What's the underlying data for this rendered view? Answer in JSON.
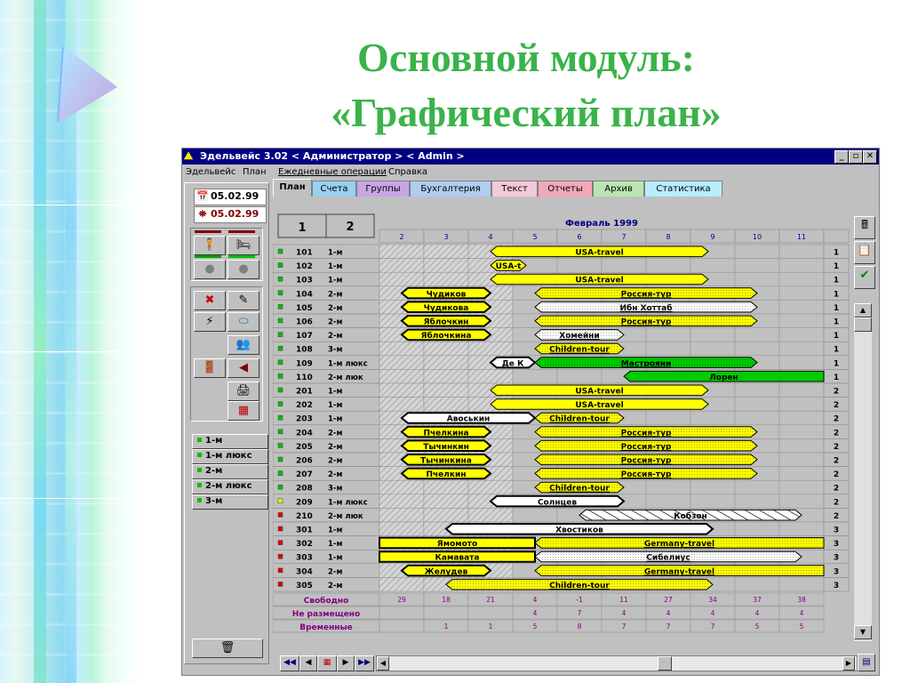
{
  "slide": {
    "title_line1": "Основной модуль:",
    "title_line2": "«Графический план»"
  },
  "app": {
    "title": "Эдельвейс 3.02 < Администратор > < Admin >",
    "menu": [
      "Эдельвейс",
      "План",
      "Ежедневные операции",
      "Справка"
    ],
    "date_today": "05.02.99",
    "date_plan": "05.02.99",
    "tabs": [
      "План",
      "Счета",
      "Группы",
      "Бухгалтерия",
      "Текст",
      "Отчеты",
      "Архив",
      "Статистика"
    ],
    "tab_colors": [
      "#c0c0c0",
      "#9ad0f0",
      "#c9a5e6",
      "#b0ccf0",
      "#f4c9d9",
      "#f2a8b8",
      "#b8e6b0",
      "#b8ecff"
    ],
    "view_buttons": [
      "1",
      "2"
    ],
    "month": "Февраль 1999",
    "days": [
      "2",
      "3",
      "4",
      "5",
      "6",
      "7",
      "8",
      "9",
      "10",
      "11"
    ],
    "room_types": [
      "1-м",
      "1-м люкс",
      "2-м",
      "2-м люкс",
      "3-м"
    ],
    "footer_labels": [
      "Свободно",
      "Не размещено",
      "Временные"
    ],
    "stats": {
      "free": [
        "29",
        "18",
        "21",
        "4",
        "-1",
        "11",
        "27",
        "34",
        "37",
        "38"
      ],
      "unplaced": [
        "",
        "",
        "",
        "4",
        "7",
        "4",
        "4",
        "4",
        "4",
        "4"
      ],
      "temp": [
        "",
        "1",
        "1",
        "5",
        "8",
        "7",
        "7",
        "7",
        "5",
        "5"
      ]
    },
    "colors": {
      "yellow": "#ffff00",
      "green": "#00cc00",
      "white": "#ffffff",
      "purple": "#b070c0",
      "navy": "#000080",
      "header_violet": "#800080"
    },
    "rooms": [
      {
        "no": "101",
        "type": "1-м",
        "floor": "1",
        "status": "green",
        "bars": [
          {
            "s": 4.5,
            "e": 9.4,
            "label": "USA-travel",
            "color": "yellow",
            "lt": true,
            "rt": true
          }
        ]
      },
      {
        "no": "102",
        "type": "1-м",
        "floor": "1",
        "status": "green",
        "bars": [
          {
            "s": 4.5,
            "e": 5.3,
            "label": "USA-t",
            "color": "yellow",
            "lt": true,
            "rt": true
          }
        ]
      },
      {
        "no": "103",
        "type": "1-м",
        "floor": "1",
        "status": "green",
        "bars": [
          {
            "s": 4.5,
            "e": 9.4,
            "label": "USA-travel",
            "color": "yellow",
            "lt": true,
            "rt": true
          }
        ]
      },
      {
        "no": "104",
        "type": "2-м",
        "floor": "1",
        "status": "green",
        "bars": [
          {
            "s": 2.5,
            "e": 4.5,
            "label": "Чудиков",
            "color": "yellow",
            "lt": true,
            "rt": true,
            "bold": true
          },
          {
            "s": 5.5,
            "e": 10.5,
            "label": "Россия-тур",
            "color": "yellow",
            "lt": true,
            "rt": true,
            "dots": true
          }
        ]
      },
      {
        "no": "105",
        "type": "2-м",
        "floor": "1",
        "status": "green",
        "bars": [
          {
            "s": 2.5,
            "e": 4.5,
            "label": "Чудикова",
            "color": "yellow",
            "lt": true,
            "rt": true,
            "bold": true
          },
          {
            "s": 5.5,
            "e": 10.5,
            "label": "Ибн Хоттаб",
            "color": "white",
            "lt": true,
            "rt": true,
            "dots": true
          }
        ]
      },
      {
        "no": "106",
        "type": "2-м",
        "floor": "1",
        "status": "green",
        "bars": [
          {
            "s": 2.5,
            "e": 4.5,
            "label": "Яблочкин",
            "color": "yellow",
            "lt": true,
            "rt": true,
            "bold": true
          },
          {
            "s": 5.5,
            "e": 10.5,
            "label": "Россия-тур",
            "color": "yellow",
            "lt": true,
            "rt": true,
            "dots": true
          }
        ]
      },
      {
        "no": "107",
        "type": "2-м",
        "floor": "1",
        "status": "green",
        "bars": [
          {
            "s": 2.5,
            "e": 4.5,
            "label": "Яблочкина",
            "color": "yellow",
            "lt": true,
            "rt": true,
            "bold": true
          },
          {
            "s": 5.5,
            "e": 7.5,
            "label": "Хомейни",
            "color": "white",
            "lt": true,
            "rt": true,
            "dots": true
          }
        ]
      },
      {
        "no": "108",
        "type": "3-м",
        "floor": "1",
        "status": "green",
        "bars": [
          {
            "s": 5.5,
            "e": 7.5,
            "label": "Children-tour",
            "color": "yellow",
            "lt": true,
            "rt": true,
            "dots": true
          }
        ]
      },
      {
        "no": "109",
        "type": "1-м люкс",
        "floor": "1",
        "status": "green",
        "bars": [
          {
            "s": 4.5,
            "e": 5.5,
            "label": "Де К",
            "color": "white",
            "lt": true,
            "rt": true,
            "bold": true
          },
          {
            "s": 5.5,
            "e": 10.5,
            "label": "Мастрояни",
            "color": "green",
            "lt": true,
            "rt": true,
            "dots": true
          }
        ]
      },
      {
        "no": "110",
        "type": "2-м люк",
        "floor": "1",
        "status": "green",
        "bars": [
          {
            "s": 7.5,
            "e": 12.6,
            "label": "Лорен",
            "color": "green",
            "lt": true,
            "rt": false
          }
        ]
      },
      {
        "no": "201",
        "type": "1-м",
        "floor": "2",
        "status": "green",
        "bars": [
          {
            "s": 4.5,
            "e": 9.4,
            "label": "USA-travel",
            "color": "yellow",
            "lt": true,
            "rt": true
          }
        ]
      },
      {
        "no": "202",
        "type": "1-м",
        "floor": "2",
        "status": "green",
        "bars": [
          {
            "s": 4.5,
            "e": 9.4,
            "label": "USA-travel",
            "color": "yellow",
            "lt": true,
            "rt": true
          }
        ]
      },
      {
        "no": "203",
        "type": "1-м",
        "floor": "2",
        "status": "green",
        "bars": [
          {
            "s": 2.5,
            "e": 5.5,
            "label": "Авоськин",
            "color": "white",
            "lt": true,
            "rt": true,
            "bold": true
          },
          {
            "s": 5.5,
            "e": 7.5,
            "label": "Children-tour",
            "color": "yellow",
            "lt": true,
            "rt": true,
            "dots": true
          }
        ]
      },
      {
        "no": "204",
        "type": "2-м",
        "floor": "2",
        "status": "green",
        "bars": [
          {
            "s": 2.5,
            "e": 4.5,
            "label": "Пчелкина",
            "color": "yellow",
            "lt": true,
            "rt": true,
            "bold": true
          },
          {
            "s": 5.5,
            "e": 10.5,
            "label": "Россия-тур",
            "color": "yellow",
            "lt": true,
            "rt": true,
            "dots": true
          }
        ]
      },
      {
        "no": "205",
        "type": "2-м",
        "floor": "2",
        "status": "green",
        "bars": [
          {
            "s": 2.5,
            "e": 4.5,
            "label": "Тычинкин",
            "color": "yellow",
            "lt": true,
            "rt": true,
            "bold": true
          },
          {
            "s": 5.5,
            "e": 10.5,
            "label": "Россия-тур",
            "color": "yellow",
            "lt": true,
            "rt": true,
            "dots": true
          }
        ]
      },
      {
        "no": "206",
        "type": "2-м",
        "floor": "2",
        "status": "green",
        "bars": [
          {
            "s": 2.5,
            "e": 4.5,
            "label": "Тычинкина",
            "color": "yellow",
            "lt": true,
            "rt": true,
            "bold": true
          },
          {
            "s": 5.5,
            "e": 10.5,
            "label": "Россия-тур",
            "color": "yellow",
            "lt": true,
            "rt": true,
            "dots": true
          }
        ]
      },
      {
        "no": "207",
        "type": "2-м",
        "floor": "2",
        "status": "green",
        "bars": [
          {
            "s": 2.5,
            "e": 4.5,
            "label": "Пчелкин",
            "color": "yellow",
            "lt": true,
            "rt": true,
            "bold": true
          },
          {
            "s": 5.5,
            "e": 10.5,
            "label": "Россия-тур",
            "color": "yellow",
            "lt": true,
            "rt": true,
            "dots": true
          }
        ]
      },
      {
        "no": "208",
        "type": "3-м",
        "floor": "2",
        "status": "green",
        "bars": [
          {
            "s": 5.5,
            "e": 7.5,
            "label": "Children-tour",
            "color": "yellow",
            "lt": true,
            "rt": true,
            "dots": true
          }
        ]
      },
      {
        "no": "209",
        "type": "1-м люкс",
        "floor": "2",
        "status": "yellow",
        "bars": [
          {
            "s": 4.5,
            "e": 7.5,
            "label": "Солнцев",
            "color": "white",
            "lt": true,
            "rt": true,
            "bold": true
          }
        ]
      },
      {
        "no": "210",
        "type": "2-м люк",
        "floor": "2",
        "status": "red",
        "bars": [
          {
            "s": 6.5,
            "e": 11.5,
            "label": "Кобзон",
            "color": "white",
            "lt": true,
            "rt": true,
            "hatch": true
          }
        ]
      },
      {
        "no": "301",
        "type": "1-м",
        "floor": "3",
        "status": "red",
        "bars": [
          {
            "s": 3.5,
            "e": 9.5,
            "label": "Хвостиков",
            "color": "white",
            "lt": true,
            "rt": true,
            "bold": true
          }
        ]
      },
      {
        "no": "302",
        "type": "1-м",
        "floor": "3",
        "status": "red",
        "bars": [
          {
            "s": 1.5,
            "e": 5.5,
            "label": "Ямомото",
            "color": "yellow",
            "lt": false,
            "rt": false,
            "bold": true
          },
          {
            "s": 5.5,
            "e": 12.6,
            "label": "Germany-travel",
            "color": "yellow",
            "lt": true,
            "rt": false,
            "dots": true
          }
        ]
      },
      {
        "no": "303",
        "type": "1-м",
        "floor": "3",
        "status": "red",
        "bars": [
          {
            "s": 1.5,
            "e": 5.5,
            "label": "Камавата",
            "color": "yellow",
            "lt": false,
            "rt": false,
            "bold": true
          },
          {
            "s": 5.5,
            "e": 11.5,
            "label": "Сибелиус",
            "color": "white",
            "lt": true,
            "rt": true,
            "dots": true
          }
        ]
      },
      {
        "no": "304",
        "type": "2-м",
        "floor": "3",
        "status": "red",
        "bars": [
          {
            "s": 2.5,
            "e": 4.5,
            "label": "Желудев",
            "color": "yellow",
            "lt": true,
            "rt": true,
            "bold": true
          },
          {
            "s": 5.5,
            "e": 12.6,
            "label": "Germany-travel",
            "color": "yellow",
            "lt": true,
            "rt": false,
            "dots": true
          }
        ]
      },
      {
        "no": "305",
        "type": "2-м",
        "floor": "3",
        "status": "red",
        "bars": [
          {
            "s": 3.5,
            "e": 9.5,
            "label": "Children-tour",
            "color": "yellow",
            "lt": true,
            "rt": true,
            "dots": true
          }
        ]
      }
    ]
  }
}
